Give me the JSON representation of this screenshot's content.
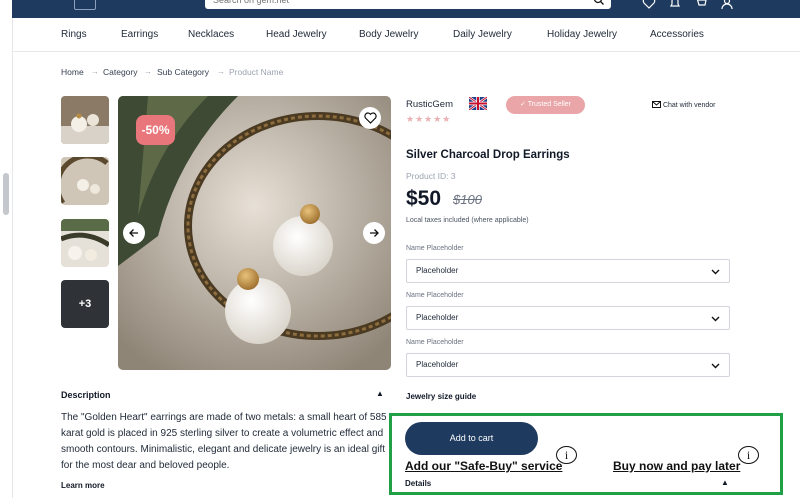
{
  "header": {
    "search_placeholder": "Search on gem.net",
    "brand_colors": {
      "navy": "#1e3a5f",
      "pink": "#e8767a",
      "green_outline": "#22a047"
    }
  },
  "categories": [
    "Rings",
    "Earrings",
    "Necklaces",
    "Head Jewelry",
    "Body Jewelry",
    "Daily Jewelry",
    "Holiday Jewelry",
    "Accessories"
  ],
  "breadcrumb": [
    "Home",
    "Category",
    "Sub Category",
    "Product Name"
  ],
  "gallery": {
    "more_count": "+3",
    "discount": "-50%"
  },
  "description": {
    "title": "Description",
    "text": "The \"Golden Heart\" earrings are made of two metals: a small heart of 585 karat gold is placed in 925 sterling silver to create a volumetric effect and smooth contours. Minimalistic, elegant and delicate jewelry is an ideal gift for the most dear and beloved people.",
    "learn_more": "Learn more"
  },
  "product": {
    "vendor": "RusticGem",
    "trusted_badge": "Trusted Seller",
    "chat": "Chat with vendor",
    "rating": 0,
    "title": "Silver Charcoal Drop Earrings",
    "product_id": "Product ID: 3",
    "price": "$50",
    "old_price": "$100",
    "tax_note": "Local taxes included (where applicable)",
    "selects": [
      {
        "label": "Name Placeholder",
        "value": "Placeholder"
      },
      {
        "label": "Name Placeholder",
        "value": "Placeholder"
      },
      {
        "label": "Name Placeholder",
        "value": "Placeholder"
      }
    ],
    "size_guide": "Jewelry size guide",
    "add_to_cart": "Add to cart",
    "safe_buy": "Add our \"Safe-Buy\" service",
    "pay_later": "Buy now and pay later",
    "info_glyph": "i",
    "details": "Details"
  }
}
